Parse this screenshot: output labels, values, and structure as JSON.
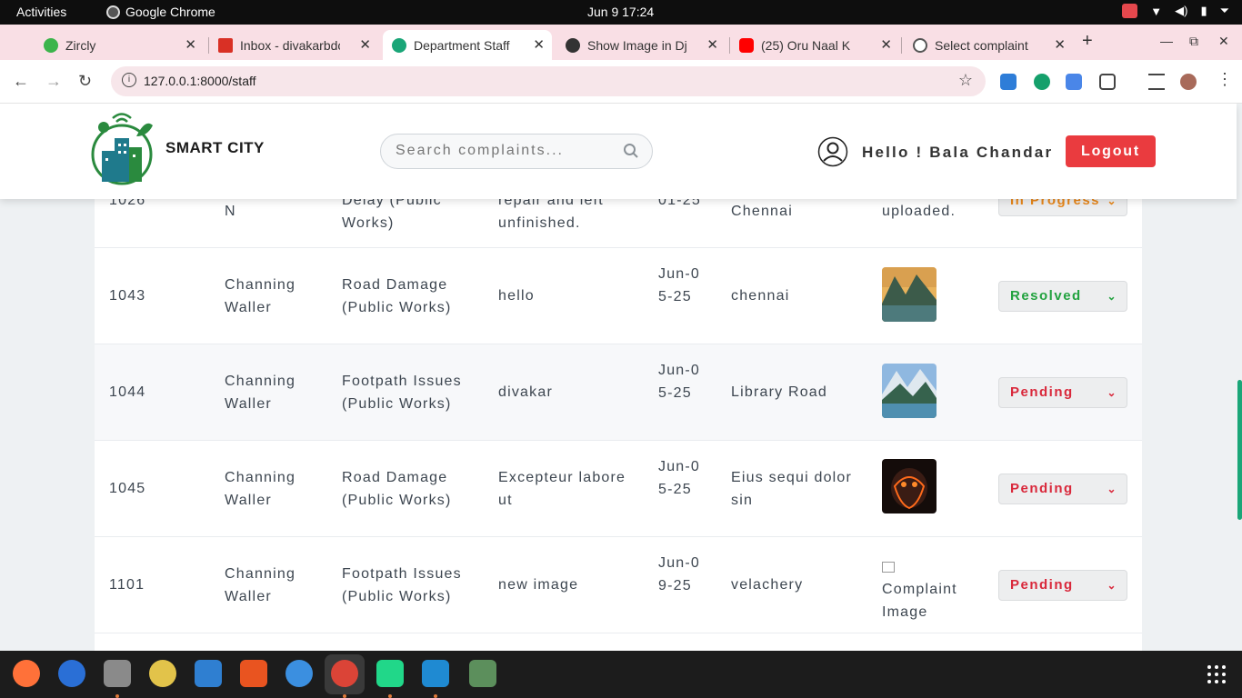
{
  "os": {
    "activities": "Activities",
    "app_name": "Google Chrome",
    "clock": "Jun 9  17:24"
  },
  "browser": {
    "tabs": [
      {
        "title": "Zircly",
        "icon_color": "#3cb44b"
      },
      {
        "title": "Inbox - divakarbdc",
        "icon_color": "#d93025"
      },
      {
        "title": "Department Staff",
        "icon_color": "#1aa678"
      },
      {
        "title": "Show Image in Dja",
        "icon_color": "#333333"
      },
      {
        "title": "(25) Oru Naal K",
        "icon_color": "#ff0000"
      },
      {
        "title": "Select complaint",
        "icon_color": "#555555"
      }
    ],
    "url": "127.0.0.1:8000/staff"
  },
  "header": {
    "brand": "SMART CITY",
    "search_placeholder": "Search complaints...",
    "greeting": "Hello ! Bala Chandar",
    "logout_label": "Logout"
  },
  "partial_row": {
    "id": "1026",
    "name": "N",
    "category": "Delay (Public Works)",
    "description": "repair and left unfinished.",
    "date": "01-25",
    "location": "Chennai",
    "image_text": "uploaded.",
    "status": "In Progress"
  },
  "complaints": [
    {
      "id": "1043",
      "name": "Channing Waller",
      "category": "Road Damage (Public Works)",
      "description": "hello",
      "date": "Jun-05-25",
      "location": "chennai",
      "status": "Resolved",
      "status_color": "#22a23f"
    },
    {
      "id": "1044",
      "name": "Channing Waller",
      "category": "Footpath Issues (Public Works)",
      "description": "divakar",
      "date": "Jun-05-25",
      "location": "Library Road",
      "status": "Pending",
      "status_color": "#d9283b"
    },
    {
      "id": "1045",
      "name": "Channing Waller",
      "category": "Road Damage (Public Works)",
      "description": "Excepteur labore ut",
      "date": "Jun-05-25",
      "location": "Eius sequi dolor sin",
      "status": "Pending",
      "status_color": "#d9283b"
    },
    {
      "id": "1101",
      "name": "Channing Waller",
      "category": "Footpath Issues (Public Works)",
      "description": "new image",
      "date": "Jun-09-25",
      "location": "velachery",
      "status": "Pending",
      "status_color": "#d9283b",
      "image_alt": "Complaint Image"
    }
  ]
}
